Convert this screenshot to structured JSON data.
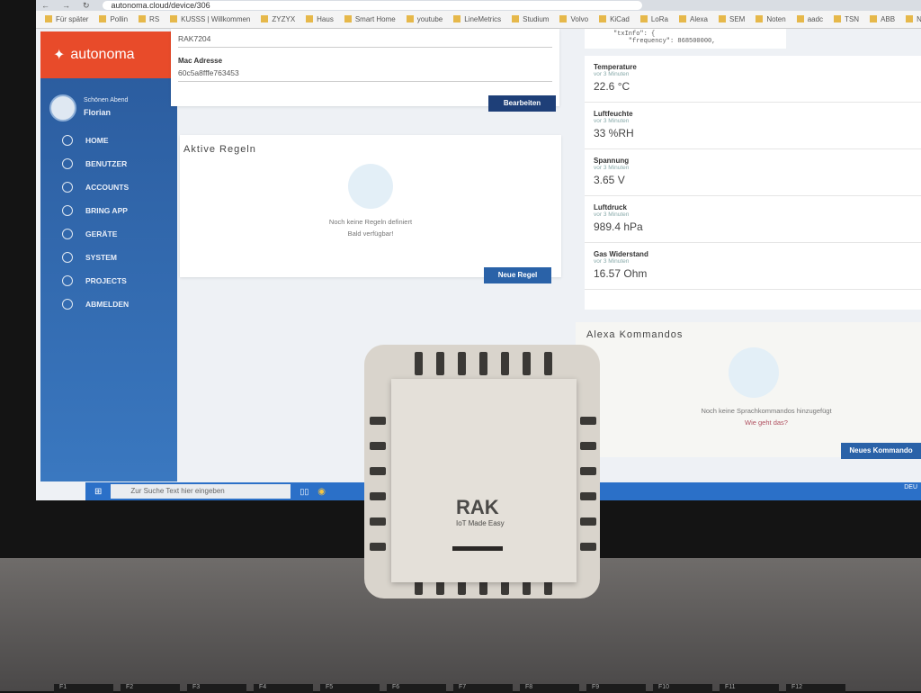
{
  "browser": {
    "url": "autonoma.cloud/device/306",
    "bookmarks": [
      "Für später",
      "Pollin",
      "RS",
      "KUSSS | Willkommen",
      "ZYZYX",
      "Haus",
      "Smart Home",
      "youtube",
      "LineMetrics",
      "Studium",
      "Volvo",
      "KiCad",
      "LoRa",
      "Alexa",
      "SEM",
      "Noten",
      "aadc",
      "TSN",
      "ABB",
      "NBIOT"
    ]
  },
  "sidebar": {
    "logo": "autonoma",
    "greeting": "Schönen Abend",
    "user": "Florian",
    "items": [
      {
        "label": "HOME"
      },
      {
        "label": "BENUTZER"
      },
      {
        "label": "ACCOUNTS"
      },
      {
        "label": "BRING APP"
      },
      {
        "label": "GERÄTE"
      },
      {
        "label": "SYSTEM"
      },
      {
        "label": "PROJECTS"
      },
      {
        "label": "ABMELDEN"
      }
    ]
  },
  "device": {
    "name": "RAK7204",
    "mac_label": "Mac Adresse",
    "mac": "60c5a8fffe763453",
    "edit": "Bearbeiten"
  },
  "rules": {
    "title": "Aktive Regeln",
    "empty": "Noch keine Regeln definiert",
    "sub": "Bald verfügbar!",
    "button": "Neue Regel"
  },
  "json_preview": "\"txInfo\": {\n    \"frequency\": 868500000,",
  "sensors": [
    {
      "name": "Temperature",
      "age": "vor 3 Minuten",
      "value": "22.6 °C"
    },
    {
      "name": "Luftfeuchte",
      "age": "vor 3 Minuten",
      "value": "33 %RH"
    },
    {
      "name": "Spannung",
      "age": "vor 3 Minuten",
      "value": "3.65 V"
    },
    {
      "name": "Luftdruck",
      "age": "vor 3 Minuten",
      "value": "989.4 hPa"
    },
    {
      "name": "Gas Widerstand",
      "age": "vor 3 Minuten",
      "value": "16.57 Ohm"
    }
  ],
  "alexa": {
    "title": "Alexa Kommandos",
    "empty": "Noch keine Sprachkommandos hinzugefügt",
    "help": "Wie geht das?",
    "button": "Neues Kommando"
  },
  "taskbar": {
    "search": "Zur Suche Text hier eingeben",
    "lang": "DEU"
  },
  "hardware": {
    "brand": "RAK",
    "tagline": "IoT Made Easy"
  },
  "keys": [
    "F1",
    "F2",
    "F3",
    "F4",
    "F5",
    "F6",
    "F7",
    "F8",
    "F9",
    "F10",
    "F11",
    "F12"
  ]
}
